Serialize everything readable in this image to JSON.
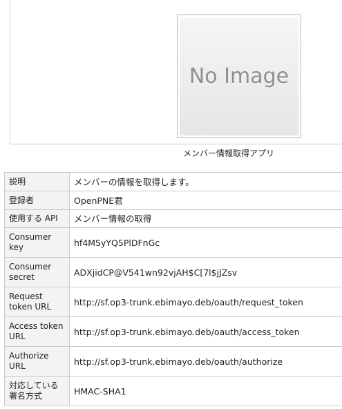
{
  "image": {
    "placeholder_text": "No Image",
    "caption": "メンバー情報取得アプリ"
  },
  "details": [
    {
      "label": "説明",
      "value": "メンバーの情報を取得します。"
    },
    {
      "label": "登録者",
      "value": "OpenPNE君"
    },
    {
      "label": "使用する API",
      "value": "メンバー情報の取得"
    },
    {
      "label": "Consumer key",
      "value": "hf4MSyYQ5PlDFnGc"
    },
    {
      "label": "Consumer secret",
      "value": "ADXjidCP@V541wn92vjAH$C[7l$jJZsv"
    },
    {
      "label": "Request token URL",
      "value": "http://sf.op3-trunk.ebimayo.deb/oauth/request_token"
    },
    {
      "label": "Access token URL",
      "value": "http://sf.op3-trunk.ebimayo.deb/oauth/access_token"
    },
    {
      "label": "Authorize URL",
      "value": "http://sf.op3-trunk.ebimayo.deb/oauth/authorize"
    },
    {
      "label": "対応している署名方式",
      "value": "HMAC-SHA1"
    }
  ]
}
